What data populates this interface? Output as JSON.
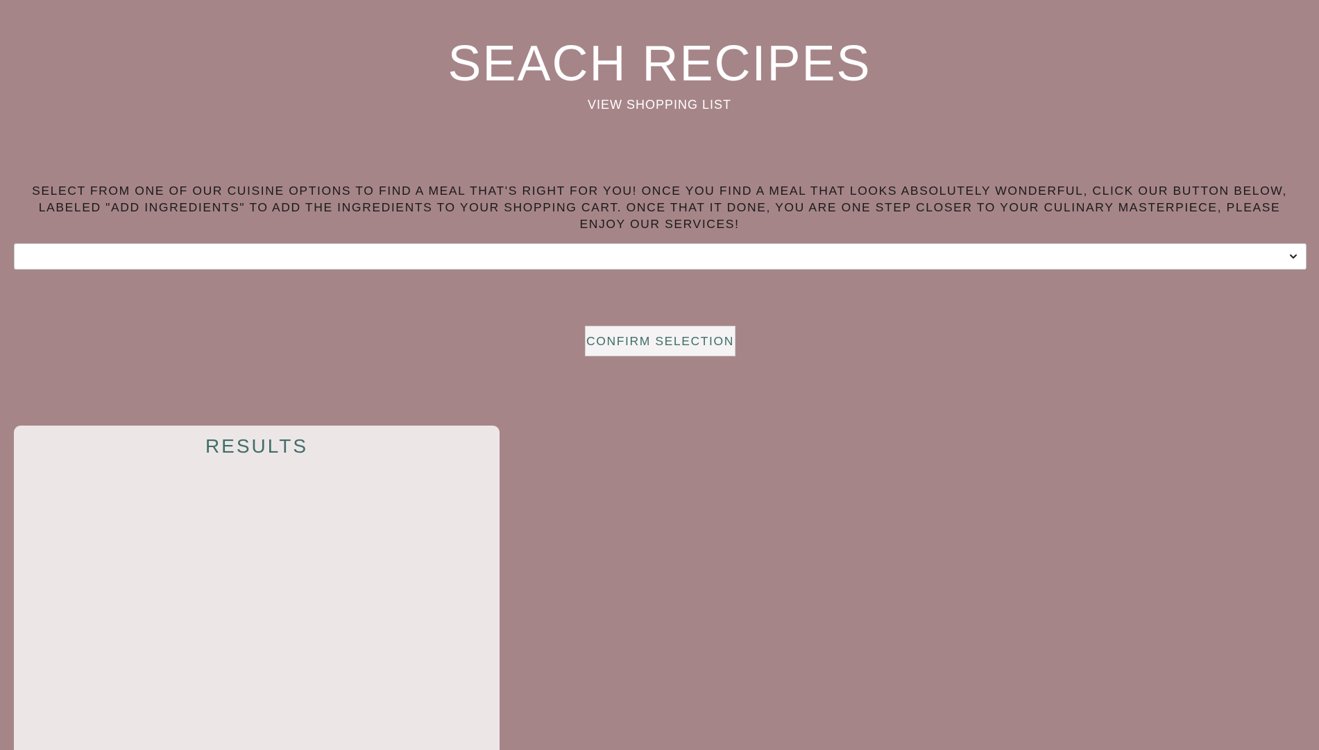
{
  "header": {
    "title": "SEACH RECIPES",
    "nav_link": "VIEW SHOPPING LIST"
  },
  "intro": {
    "text": "SELECT FROM ONE OF OUR CUISINE OPTIONS TO FIND A MEAL THAT'S RIGHT FOR YOU! ONCE YOU FIND A MEAL THAT LOOKS ABSOLUTELY WONDERFUL, CLICK OUR BUTTON BELOW, LABELED \"ADD INGREDIENTS\" TO ADD THE INGREDIENTS TO YOUR SHOPPING CART. ONCE THAT IT DONE, YOU ARE ONE STEP CLOSER TO YOUR CULINARY MASTERPIECE, PLEASE ENJOY OUR SERVICES!"
  },
  "cuisine_select": {
    "selected_value": "",
    "chevron_icon": "chevron-down-icon"
  },
  "confirm_button": {
    "label": "CONFIRM SELECTION"
  },
  "results": {
    "title": "RESULTS"
  },
  "colors": {
    "background": "#a68588",
    "card": "#ede6e7",
    "accent": "#3f6e68",
    "title_text": "#ffffff"
  }
}
